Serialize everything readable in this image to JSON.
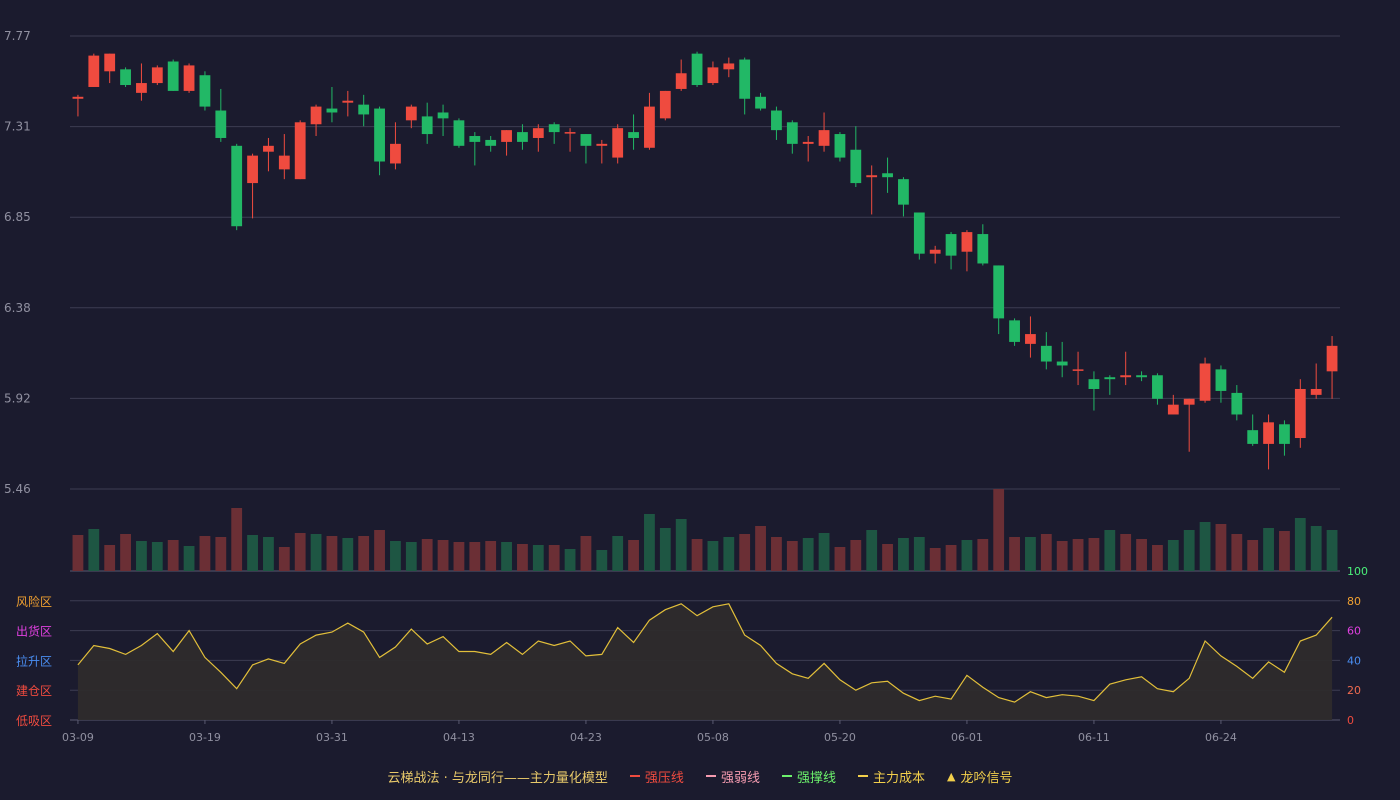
{
  "chart_data": [
    {
      "type": "candlestick",
      "yticks": [
        "7.77",
        "7.31",
        "6.85",
        "6.38",
        "5.92",
        "5.46"
      ],
      "ylim": [
        5.46,
        7.77
      ],
      "xticks": [
        "03-09",
        "03-19",
        "03-31",
        "04-13",
        "04-23",
        "05-08",
        "05-20",
        "06-01",
        "06-11",
        "06-24"
      ],
      "grid": true,
      "candles": [
        [
          7.45,
          7.46,
          7.36,
          7.47
        ],
        [
          7.51,
          7.67,
          7.51,
          7.68
        ],
        [
          7.59,
          7.68,
          7.53,
          7.68
        ],
        [
          7.6,
          7.52,
          7.51,
          7.61
        ],
        [
          7.48,
          7.53,
          7.44,
          7.63
        ],
        [
          7.53,
          7.61,
          7.52,
          7.62
        ],
        [
          7.64,
          7.49,
          7.49,
          7.65
        ],
        [
          7.49,
          7.62,
          7.48,
          7.63
        ],
        [
          7.57,
          7.41,
          7.39,
          7.59
        ],
        [
          7.39,
          7.25,
          7.23,
          7.5
        ],
        [
          7.21,
          6.8,
          6.78,
          7.22
        ],
        [
          7.02,
          7.16,
          6.84,
          7.17
        ],
        [
          7.18,
          7.21,
          7.08,
          7.25
        ],
        [
          7.09,
          7.16,
          7.04,
          7.27
        ],
        [
          7.04,
          7.33,
          7.04,
          7.34
        ],
        [
          7.32,
          7.41,
          7.26,
          7.42
        ],
        [
          7.4,
          7.38,
          7.33,
          7.51
        ],
        [
          7.43,
          7.44,
          7.36,
          7.49
        ],
        [
          7.42,
          7.37,
          7.31,
          7.47
        ],
        [
          7.4,
          7.13,
          7.06,
          7.41
        ],
        [
          7.12,
          7.22,
          7.09,
          7.33
        ],
        [
          7.34,
          7.41,
          7.3,
          7.42
        ],
        [
          7.36,
          7.27,
          7.22,
          7.43
        ],
        [
          7.38,
          7.35,
          7.26,
          7.42
        ],
        [
          7.34,
          7.21,
          7.2,
          7.35
        ],
        [
          7.26,
          7.23,
          7.11,
          7.28
        ],
        [
          7.24,
          7.21,
          7.18,
          7.26
        ],
        [
          7.23,
          7.29,
          7.16,
          7.29
        ],
        [
          7.28,
          7.23,
          7.19,
          7.32
        ],
        [
          7.25,
          7.3,
          7.18,
          7.32
        ],
        [
          7.32,
          7.28,
          7.22,
          7.33
        ],
        [
          7.28,
          7.28,
          7.18,
          7.3
        ],
        [
          7.27,
          7.21,
          7.12,
          7.27
        ],
        [
          7.21,
          7.22,
          7.12,
          7.24
        ],
        [
          7.15,
          7.3,
          7.12,
          7.32
        ],
        [
          7.28,
          7.25,
          7.19,
          7.37
        ],
        [
          7.2,
          7.41,
          7.19,
          7.48
        ],
        [
          7.35,
          7.49,
          7.34,
          7.49
        ],
        [
          7.5,
          7.58,
          7.49,
          7.65
        ],
        [
          7.68,
          7.52,
          7.51,
          7.69
        ],
        [
          7.53,
          7.61,
          7.52,
          7.64
        ],
        [
          7.6,
          7.63,
          7.56,
          7.66
        ],
        [
          7.65,
          7.45,
          7.37,
          7.66
        ],
        [
          7.46,
          7.4,
          7.39,
          7.48
        ],
        [
          7.39,
          7.29,
          7.24,
          7.41
        ],
        [
          7.33,
          7.22,
          7.17,
          7.34
        ],
        [
          7.22,
          7.23,
          7.13,
          7.26
        ],
        [
          7.21,
          7.29,
          7.18,
          7.38
        ],
        [
          7.27,
          7.15,
          7.13,
          7.28
        ],
        [
          7.19,
          7.02,
          7.0,
          7.31
        ],
        [
          7.05,
          7.06,
          6.86,
          7.11
        ],
        [
          7.07,
          7.05,
          6.97,
          7.15
        ],
        [
          7.04,
          6.91,
          6.85,
          7.05
        ],
        [
          6.87,
          6.66,
          6.63,
          6.87
        ],
        [
          6.66,
          6.68,
          6.61,
          6.7
        ],
        [
          6.76,
          6.65,
          6.58,
          6.77
        ],
        [
          6.67,
          6.77,
          6.57,
          6.78
        ],
        [
          6.76,
          6.61,
          6.6,
          6.81
        ],
        [
          6.6,
          6.33,
          6.25,
          6.6
        ],
        [
          6.32,
          6.21,
          6.19,
          6.33
        ],
        [
          6.2,
          6.25,
          6.13,
          6.34
        ],
        [
          6.19,
          6.11,
          6.07,
          6.26
        ],
        [
          6.11,
          6.09,
          6.03,
          6.21
        ],
        [
          6.07,
          6.07,
          5.99,
          6.16
        ],
        [
          6.02,
          5.97,
          5.86,
          6.06
        ],
        [
          6.03,
          6.02,
          5.94,
          6.04
        ],
        [
          6.03,
          6.04,
          5.99,
          6.16
        ],
        [
          6.04,
          6.03,
          6.01,
          6.06
        ],
        [
          6.04,
          5.92,
          5.89,
          6.05
        ],
        [
          5.84,
          5.89,
          5.84,
          5.94
        ],
        [
          5.89,
          5.92,
          5.65,
          5.92
        ],
        [
          5.91,
          6.1,
          5.9,
          6.13
        ],
        [
          6.07,
          5.96,
          5.9,
          6.09
        ],
        [
          5.95,
          5.84,
          5.81,
          5.99
        ],
        [
          5.76,
          5.69,
          5.68,
          5.84
        ],
        [
          5.69,
          5.8,
          5.56,
          5.84
        ],
        [
          5.79,
          5.69,
          5.63,
          5.81
        ],
        [
          5.72,
          5.97,
          5.67,
          6.02
        ],
        [
          5.94,
          5.97,
          5.92,
          6.1
        ],
        [
          6.06,
          6.19,
          5.92,
          6.24
        ]
      ],
      "volume": [
        [
          36,
          "up"
        ],
        [
          42,
          "down"
        ],
        [
          26,
          "up"
        ],
        [
          37,
          "up"
        ],
        [
          30,
          "down"
        ],
        [
          29,
          "down"
        ],
        [
          31,
          "up"
        ],
        [
          25,
          "down"
        ],
        [
          35,
          "up"
        ],
        [
          34,
          "up"
        ],
        [
          63,
          "up"
        ],
        [
          36,
          "down"
        ],
        [
          34,
          "down"
        ],
        [
          24,
          "up"
        ],
        [
          38,
          "up"
        ],
        [
          37,
          "down"
        ],
        [
          35,
          "up"
        ],
        [
          33,
          "down"
        ],
        [
          35,
          "up"
        ],
        [
          41,
          "up"
        ],
        [
          30,
          "down"
        ],
        [
          29,
          "down"
        ],
        [
          32,
          "up"
        ],
        [
          31,
          "up"
        ],
        [
          29,
          "up"
        ],
        [
          29,
          "up"
        ],
        [
          30,
          "up"
        ],
        [
          29,
          "down"
        ],
        [
          27,
          "up"
        ],
        [
          26,
          "down"
        ],
        [
          26,
          "up"
        ],
        [
          22,
          "down"
        ],
        [
          35,
          "up"
        ],
        [
          21,
          "down"
        ],
        [
          35,
          "down"
        ],
        [
          31,
          "up"
        ],
        [
          57,
          "down"
        ],
        [
          43,
          "down"
        ],
        [
          52,
          "down"
        ],
        [
          32,
          "up"
        ],
        [
          30,
          "down"
        ],
        [
          34,
          "down"
        ],
        [
          37,
          "up"
        ],
        [
          45,
          "up"
        ],
        [
          34,
          "up"
        ],
        [
          30,
          "up"
        ],
        [
          33,
          "down"
        ],
        [
          38,
          "down"
        ],
        [
          24,
          "up"
        ],
        [
          31,
          "up"
        ],
        [
          41,
          "down"
        ],
        [
          27,
          "up"
        ],
        [
          33,
          "down"
        ],
        [
          34,
          "down"
        ],
        [
          23,
          "up"
        ],
        [
          26,
          "up"
        ],
        [
          31,
          "down"
        ],
        [
          32,
          "up"
        ],
        [
          82,
          "up"
        ],
        [
          34,
          "up"
        ],
        [
          34,
          "down"
        ],
        [
          37,
          "up"
        ],
        [
          30,
          "up"
        ],
        [
          32,
          "up"
        ],
        [
          33,
          "up"
        ],
        [
          41,
          "down"
        ],
        [
          37,
          "up"
        ],
        [
          32,
          "up"
        ],
        [
          26,
          "up"
        ],
        [
          31,
          "down"
        ],
        [
          41,
          "down"
        ],
        [
          49,
          "down"
        ],
        [
          47,
          "up"
        ],
        [
          37,
          "up"
        ],
        [
          31,
          "up"
        ],
        [
          43,
          "down"
        ],
        [
          40,
          "up"
        ],
        [
          53,
          "down"
        ],
        [
          45,
          "down"
        ],
        [
          41,
          "down"
        ]
      ]
    },
    {
      "type": "area",
      "left_labels": [
        "风险区",
        "出货区",
        "拉升区",
        "建仓区",
        "低吸区"
      ],
      "right_ticks": [
        "100",
        "80",
        "60",
        "40",
        "20",
        "0"
      ],
      "ylim": [
        0,
        100
      ],
      "values": [
        37,
        50,
        48,
        44,
        50,
        58,
        46,
        60,
        42,
        32,
        21,
        37,
        41,
        38,
        51,
        57,
        59,
        65,
        59,
        42,
        49,
        61,
        51,
        56,
        46,
        46,
        44,
        52,
        44,
        53,
        50,
        53,
        43,
        44,
        62,
        52,
        67,
        74,
        78,
        70,
        76,
        78,
        57,
        50,
        38,
        31,
        28,
        38,
        27,
        20,
        25,
        26,
        18,
        13,
        16,
        14,
        30,
        22,
        15,
        12,
        19,
        15,
        17,
        16,
        13,
        24,
        27,
        29,
        21,
        19,
        28,
        53,
        43,
        36,
        28,
        39,
        32,
        53,
        57,
        69
      ]
    },
    {
      "type": "legend",
      "title": "云梯战法 · 与龙同行——主力量化模型",
      "items": [
        {
          "label": "强压线",
          "color": "#ef4b3f",
          "style": "solid"
        },
        {
          "label": "强弱线",
          "color": "#f59bb0",
          "style": "dashed"
        },
        {
          "label": "强撑线",
          "color": "#6cf06c",
          "style": "solid"
        },
        {
          "label": "主力成本",
          "color": "#f2cf4b",
          "style": "dashed"
        },
        {
          "label": "龙吟信号",
          "color": "#f2cf4b",
          "style": "triangle"
        }
      ]
    }
  ],
  "colors": {
    "up": "#ef4b3f",
    "down": "#22b866",
    "vol_up": "#6b2f35",
    "vol_down": "#1e5643",
    "grid": "#3c3c52",
    "tick_text": "#9090a0",
    "line": "#e2bf3a",
    "area_fill": "#2e2b2c",
    "risk": "#f0a030",
    "dist": "#e040e0",
    "rise": "#4a8ef2",
    "build": "#ef4b3f",
    "low": "#ef4b3f",
    "r100": "#4af07a",
    "r80": "#f0a030",
    "r60": "#e040e0",
    "r40": "#4a8ef2",
    "r20": "#ef6a4f",
    "r0": "#ef4b3f"
  }
}
